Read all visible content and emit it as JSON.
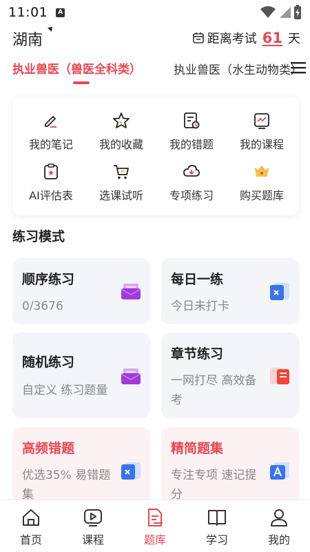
{
  "status_bar": {
    "time": "11:01",
    "a_badge": "A"
  },
  "header": {
    "region": "湖南",
    "countdown_prefix": "距离考试",
    "countdown_days": "61",
    "countdown_suffix": "天"
  },
  "category_tabs": [
    {
      "label": "执业兽医（兽医全科类）",
      "active": true
    },
    {
      "label": "执业兽医（水生动物类）",
      "active": false
    }
  ],
  "tools": [
    {
      "label": "我的笔记",
      "icon": "note-icon"
    },
    {
      "label": "我的收藏",
      "icon": "star-icon"
    },
    {
      "label": "我的错题",
      "icon": "wrong-questions-icon"
    },
    {
      "label": "我的课程",
      "icon": "course-icon"
    },
    {
      "label": "AI评估表",
      "icon": "assessment-icon"
    },
    {
      "label": "选课试听",
      "icon": "cart-icon"
    },
    {
      "label": "专项练习",
      "icon": "special-practice-icon"
    },
    {
      "label": "购买题库",
      "icon": "buy-bank-icon"
    }
  ],
  "practice_section_title": "练习模式",
  "practice_cards": [
    {
      "title": "顺序练习",
      "sub": "0/3676",
      "icon": "envelope-purple-icon"
    },
    {
      "title": "每日一练",
      "sub": "今日未打卡",
      "icon": "calendar-blue-icon"
    },
    {
      "title": "随机练习",
      "sub": "自定义 练习题量",
      "icon": "envelope-purple-icon"
    },
    {
      "title": "章节练习",
      "sub": "一网打尽 高效备考",
      "icon": "book-red-icon"
    },
    {
      "title": "高频错题",
      "sub": "优选35% 易错题集",
      "icon": "calendar-blue-icon"
    },
    {
      "title": "精简题集",
      "sub": "专注专项 速记提分",
      "icon": "translate-blue-icon"
    }
  ],
  "bottom_nav": [
    {
      "label": "首页",
      "icon": "home-icon",
      "active": false
    },
    {
      "label": "课程",
      "icon": "play-icon",
      "active": false
    },
    {
      "label": "题库",
      "icon": "question-bank-icon",
      "active": true
    },
    {
      "label": "学习",
      "icon": "book-icon",
      "active": false
    },
    {
      "label": "我的",
      "icon": "user-icon",
      "active": false
    }
  ],
  "colors": {
    "accent": "#e24a55",
    "card_bg": "#f4f5f8",
    "pink_card_bg": "#fdf2f3",
    "purple": "#a23ad9",
    "blue": "#3a72e8"
  }
}
